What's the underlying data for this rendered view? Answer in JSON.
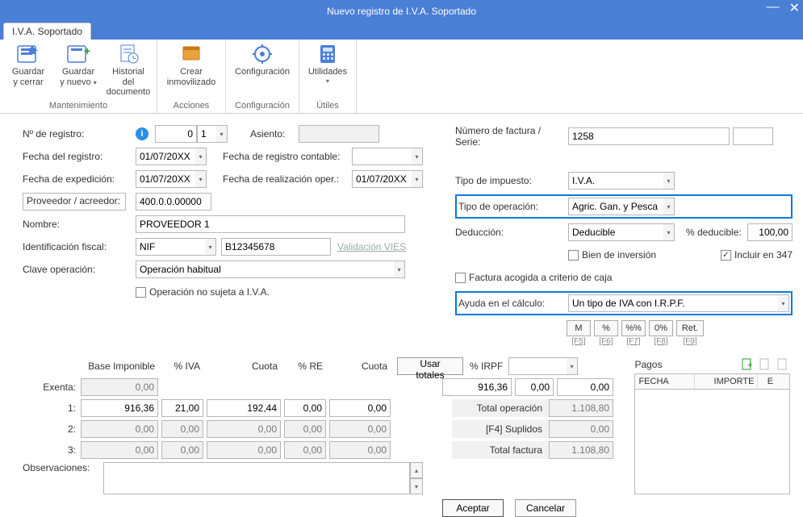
{
  "title": "Nuevo registro de I.V.A. Soportado",
  "tab": "I.V.A. Soportado",
  "ribbon": {
    "groups": [
      {
        "label": "Mantenimiento",
        "items": [
          {
            "label1": "Guardar",
            "label2": "y cerrar",
            "name": "save-close-btn",
            "dd": false
          },
          {
            "label1": "Guardar",
            "label2": "y nuevo",
            "name": "save-new-btn",
            "dd": true
          },
          {
            "label1": "Historial del",
            "label2": "documento",
            "name": "doc-history-btn",
            "dd": false
          }
        ]
      },
      {
        "label": "Acciones",
        "items": [
          {
            "label1": "Crear",
            "label2": "inmovilizado",
            "name": "create-asset-btn",
            "dd": false
          }
        ]
      },
      {
        "label": "Configuración",
        "items": [
          {
            "label1": "Configuración",
            "label2": "",
            "name": "config-btn",
            "dd": false
          }
        ]
      },
      {
        "label": "Útiles",
        "items": [
          {
            "label1": "Utilidades",
            "label2": "",
            "name": "utils-btn",
            "dd": true
          }
        ]
      }
    ]
  },
  "form": {
    "num_registro_label": "Nº de registro:",
    "num_registro_val": "0",
    "num_registro_serie": "1",
    "fecha_registro_label": "Fecha del registro:",
    "fecha_registro_val": "01/07/20XX",
    "fecha_exped_label": "Fecha de expedición:",
    "fecha_exped_val": "01/07/20XX",
    "proveedor_label": "Proveedor / acreedor:",
    "proveedor_val": "400.0.0.00000",
    "nombre_label": "Nombre:",
    "nombre_val": "PROVEEDOR 1",
    "id_fiscal_label": "Identificación fiscal:",
    "id_fiscal_tipo": "NIF",
    "id_fiscal_num": "B12345678",
    "valid_vies": "Validación VIES",
    "clave_op_label": "Clave operación:",
    "clave_op_val": "Operación habitual",
    "op_no_sujeta": "Operación no sujeta a I.V.A.",
    "asiento_label": "Asiento:",
    "fecha_reg_cont_label": "Fecha de registro contable:",
    "fecha_reg_cont_val": "",
    "fecha_real_op_label": "Fecha de realización oper.:",
    "fecha_real_op_val": "01/07/20XX",
    "num_factura_label": "Número de factura / Serie:",
    "num_factura_val": "1258",
    "tipo_impuesto_label": "Tipo de impuesto:",
    "tipo_impuesto_val": "I.V.A.",
    "tipo_operacion_label": "Tipo de operación:",
    "tipo_operacion_val": "Agric. Gan. y Pesca",
    "deduccion_label": "Deducción:",
    "deduccion_val": "Deducible",
    "pct_deducible_label": "% deducible:",
    "pct_deducible_val": "100,00",
    "bien_inversion": "Bien de inversión",
    "incluir_347": "Incluir en 347",
    "fact_criterio_caja": "Factura acogida a criterio de caja",
    "ayuda_calc_label": "Ayuda en el cálculo:",
    "ayuda_calc_val": "Un tipo de IVA con I.R.P.F.",
    "qbtns": [
      {
        "t": "M",
        "k": "[F5]"
      },
      {
        "t": "%",
        "k": "[F6]"
      },
      {
        "t": "%%",
        "k": "[F7]"
      },
      {
        "t": "0%",
        "k": "[F8]"
      },
      {
        "t": "Ret.",
        "k": "[F9]"
      }
    ]
  },
  "grid": {
    "headers": {
      "base": "Base Imponible",
      "pct_iva": "% IVA",
      "cuota": "Cuota",
      "pct_re": "% RE",
      "cuota2": "Cuota",
      "usar_totales": "Usar totales",
      "pct_irpf": "% IRPF"
    },
    "rows": [
      {
        "label": "Exenta:",
        "base": "0,00",
        "pctiva": "",
        "cuota": "",
        "pctre": "",
        "cuota2": ""
      },
      {
        "label": "1:",
        "base": "916,36",
        "pctiva": "21,00",
        "cuota": "192,44",
        "pctre": "0,00",
        "cuota2": "0,00"
      },
      {
        "label": "2:",
        "base": "0,00",
        "pctiva": "0,00",
        "cuota": "0,00",
        "pctre": "0,00",
        "cuota2": "0,00"
      },
      {
        "label": "3:",
        "base": "0,00",
        "pctiva": "0,00",
        "cuota": "0,00",
        "pctre": "0,00",
        "cuota2": "0,00"
      }
    ],
    "irpf": {
      "base": "916,36",
      "pct": "0,00",
      "cuota": "0,00"
    },
    "totals": [
      {
        "label": "Total operación",
        "val": "1.108,80"
      },
      {
        "label": "[F4] Suplidos",
        "val": "0,00"
      },
      {
        "label": "Total factura",
        "val": "1.108,80"
      }
    ],
    "pagos": {
      "title": "Pagos",
      "cols": [
        "FECHA",
        "IMPORTE",
        "E"
      ]
    },
    "observ_label": "Observaciones:"
  },
  "actions": {
    "ok": "Aceptar",
    "cancel": "Cancelar"
  }
}
